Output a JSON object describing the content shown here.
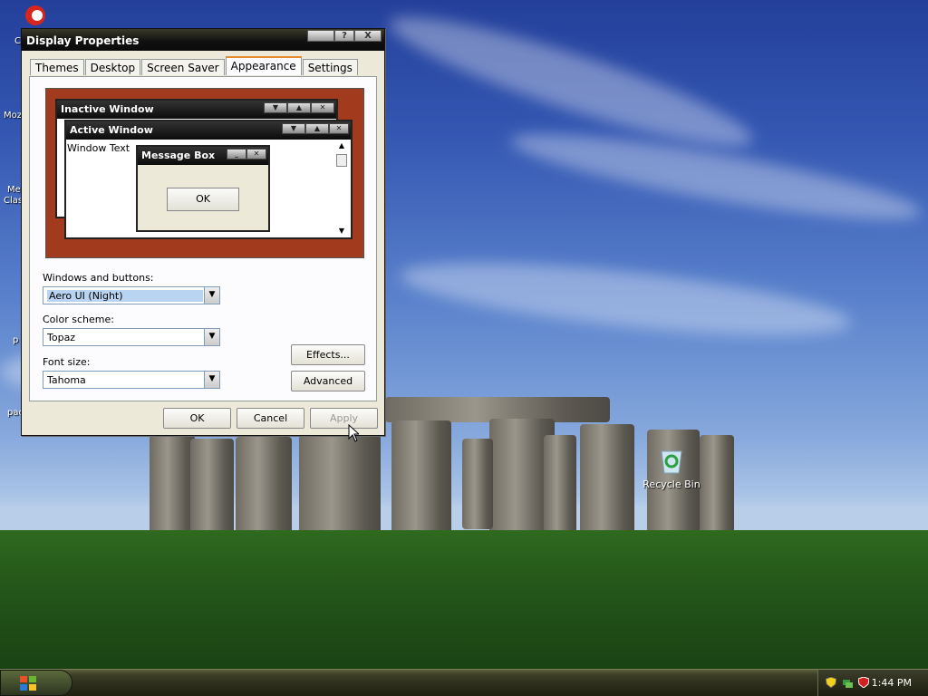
{
  "desktop": {
    "left_icon_labels": [
      "C",
      "Moz",
      "Me",
      "Clas",
      "p",
      "pac"
    ],
    "recycle_bin_label": "Recycle Bin"
  },
  "dialog": {
    "title": "Display Properties",
    "title_buttons": [
      "",
      "?",
      "X"
    ],
    "tabs": [
      "Themes",
      "Desktop",
      "Screen Saver",
      "Appearance",
      "Settings"
    ],
    "active_tab": "Appearance",
    "preview": {
      "inactive_title": "Inactive Window",
      "active_title": "Active Window",
      "window_text": "Window Text",
      "message_box_title": "Message Box",
      "ok_label": "OK"
    },
    "windows_buttons_label": "Windows and buttons:",
    "windows_buttons_value": "Aero UI (Night)",
    "color_scheme_label": "Color scheme:",
    "color_scheme_value": "Topaz",
    "font_size_label": "Font size:",
    "font_size_value": "Tahoma",
    "effects_label": "Effects...",
    "advanced_label": "Advanced",
    "ok_label": "OK",
    "cancel_label": "Cancel",
    "apply_label": "Apply"
  },
  "taskbar": {
    "clock": "1:44 PM"
  },
  "colors": {
    "preview_background": "#a23a1e",
    "active_tab_accent": "#e68b2c"
  }
}
